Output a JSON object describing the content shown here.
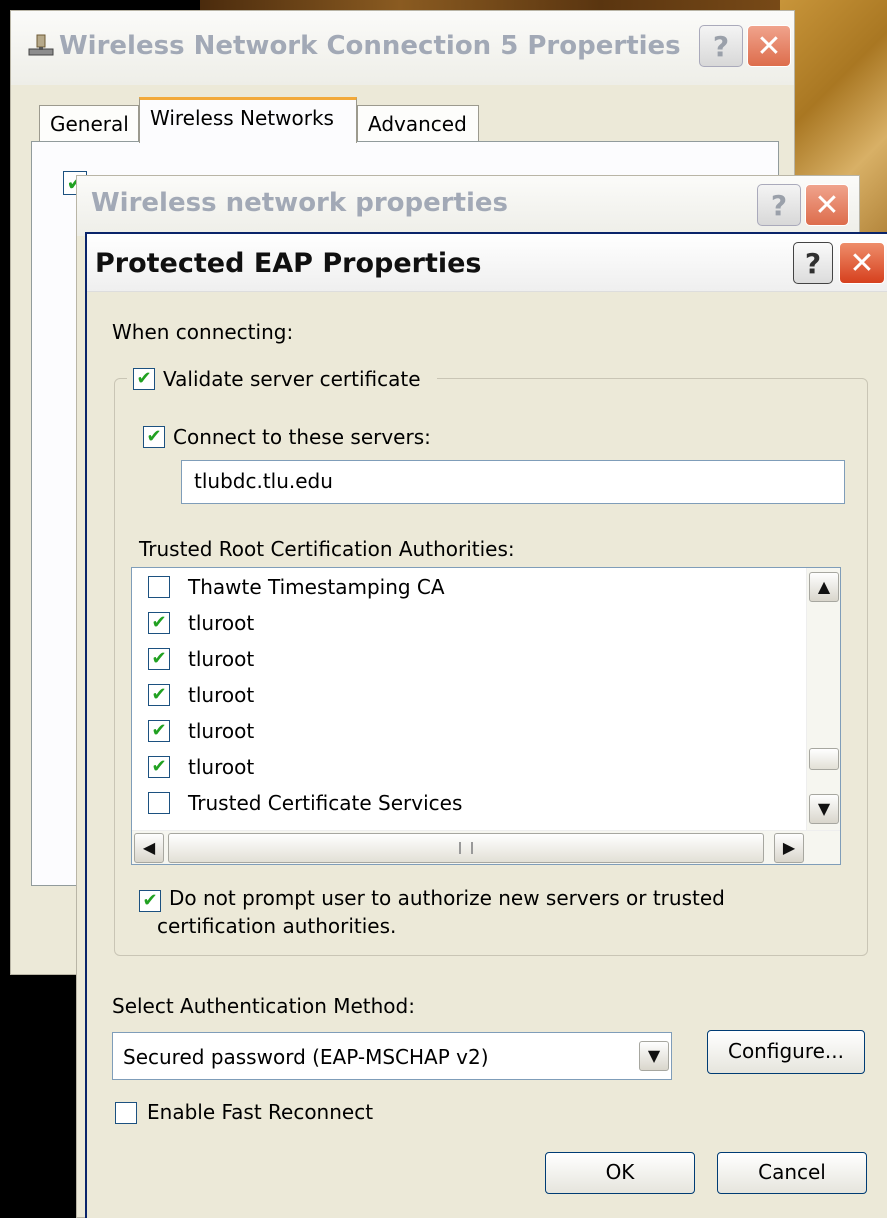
{
  "outer_window": {
    "title": "Wireless Network Connection 5 Properties",
    "tabs": [
      "General",
      "Wireless Networks",
      "Advanced"
    ],
    "active_tab": "Wireless Networks",
    "help": "?",
    "close": "✕"
  },
  "middle_window": {
    "title": "Wireless network properties",
    "help": "?",
    "close": "✕"
  },
  "dialog": {
    "title": "Protected EAP Properties",
    "help": "?",
    "close": "✕",
    "when_connecting": "When connecting:",
    "validate_label": "Validate server certificate",
    "validate_checked": true,
    "connect_label": "Connect to these servers:",
    "connect_checked": true,
    "servers_value": "tlubdc.tlu.edu",
    "trusted_label": "Trusted Root Certification Authorities:",
    "ca_list": [
      {
        "name": "Thawte Timestamping CA",
        "checked": false
      },
      {
        "name": "tluroot",
        "checked": true
      },
      {
        "name": "tluroot",
        "checked": true
      },
      {
        "name": "tluroot",
        "checked": true
      },
      {
        "name": "tluroot",
        "checked": true
      },
      {
        "name": "tluroot",
        "checked": true
      },
      {
        "name": "Trusted Certificate Services",
        "checked": false
      }
    ],
    "no_prompt_line1": "Do not prompt user to authorize new servers or trusted",
    "no_prompt_line2": "certification authorities.",
    "no_prompt_checked": true,
    "auth_label": "Select Authentication Method:",
    "auth_value": "Secured password (EAP-MSCHAP v2)",
    "configure": "Configure...",
    "fast_reconnect": "Enable Fast Reconnect",
    "fast_reconnect_checked": false,
    "ok": "OK",
    "cancel": "Cancel",
    "check_glyph": "✔"
  }
}
